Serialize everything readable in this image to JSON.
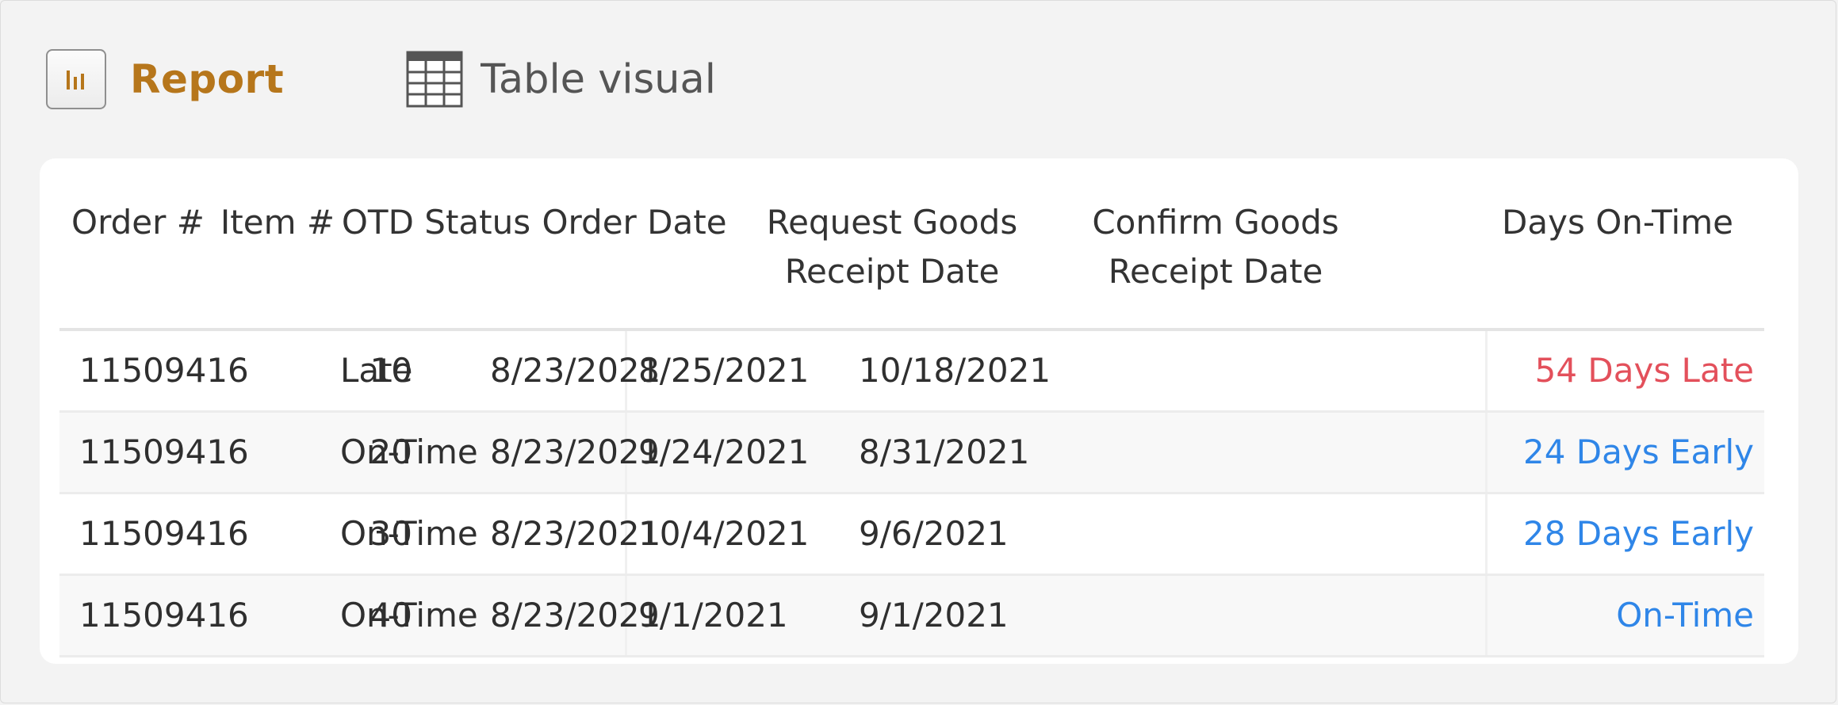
{
  "header": {
    "report_label": "Report",
    "visual_label": "Table visual"
  },
  "table": {
    "columns": [
      "Order #",
      "Item #",
      "OTD Status",
      "Order Date",
      "Request Goods\nReceipt Date",
      "Confirm Goods\nReceipt Date",
      "Days On-Time"
    ],
    "rows": [
      [
        "11509416",
        "10",
        "Late",
        "8/23/2021",
        "8/25/2021",
        "10/18/2021",
        "54 Days Late"
      ],
      [
        "11509416",
        "20",
        "On-Time",
        "8/23/2021",
        "9/24/2021",
        "8/31/2021",
        "24 Days Early"
      ],
      [
        "11509416",
        "30",
        "On-Time",
        "8/23/2021",
        "10/4/2021",
        "9/6/2021",
        "28 Days Early"
      ],
      [
        "11509416",
        "40",
        "On-Time",
        "8/23/2021",
        "9/1/2021",
        "9/1/2021",
        "On-Time"
      ]
    ]
  },
  "colors": {
    "accent": "#b6761b",
    "late": "#e3505b",
    "early": "#2f86e8"
  }
}
